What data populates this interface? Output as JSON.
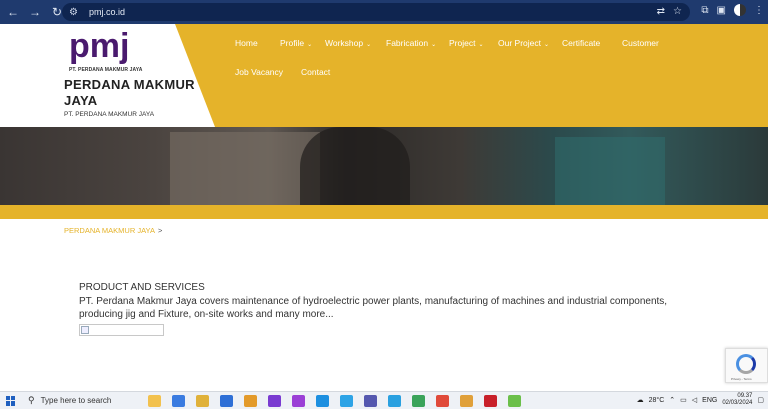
{
  "browser": {
    "url": "pmj.co.id",
    "back_icon": "back-arrow-icon",
    "forward_icon": "forward-arrow-icon",
    "reload_icon": "reload-icon"
  },
  "site": {
    "logo_text": "pmj",
    "logo_tagline": "PT. PERDANA MAKMUR JAYA",
    "name": "PERDANA MAKMUR JAYA",
    "subtitle": "PT. PERDANA MAKMUR JAYA",
    "brand_color": "#e5b32a",
    "logo_color": "#4a1a6e"
  },
  "menu": {
    "row1": [
      {
        "label": "Home",
        "has_submenu": false
      },
      {
        "label": "Profile",
        "has_submenu": true
      },
      {
        "label": "Workshop",
        "has_submenu": true
      },
      {
        "label": "Fabrication",
        "has_submenu": true
      },
      {
        "label": "Project",
        "has_submenu": true
      },
      {
        "label": "Our Project",
        "has_submenu": true
      },
      {
        "label": "Certificate",
        "has_submenu": false
      },
      {
        "label": "Customer",
        "has_submenu": false
      }
    ],
    "row2": [
      {
        "label": "Job Vacancy",
        "has_submenu": false
      },
      {
        "label": "Contact",
        "has_submenu": false
      }
    ]
  },
  "breadcrumb": {
    "item": "PERDANA MAKMUR JAYA",
    "separator": ">"
  },
  "content": {
    "title": "PRODUCT AND SERVICES",
    "description": "PT. Perdana Makmur Jaya covers maintenance of hydroelectric power plants, manufacturing of machines and industrial components, producing jig and Fixture, on-site works and many more..."
  },
  "taskbar": {
    "search_placeholder": "Type here to search",
    "weather": "28°C",
    "language": "ENG",
    "time": "09.37",
    "date": "02/03/2024"
  }
}
